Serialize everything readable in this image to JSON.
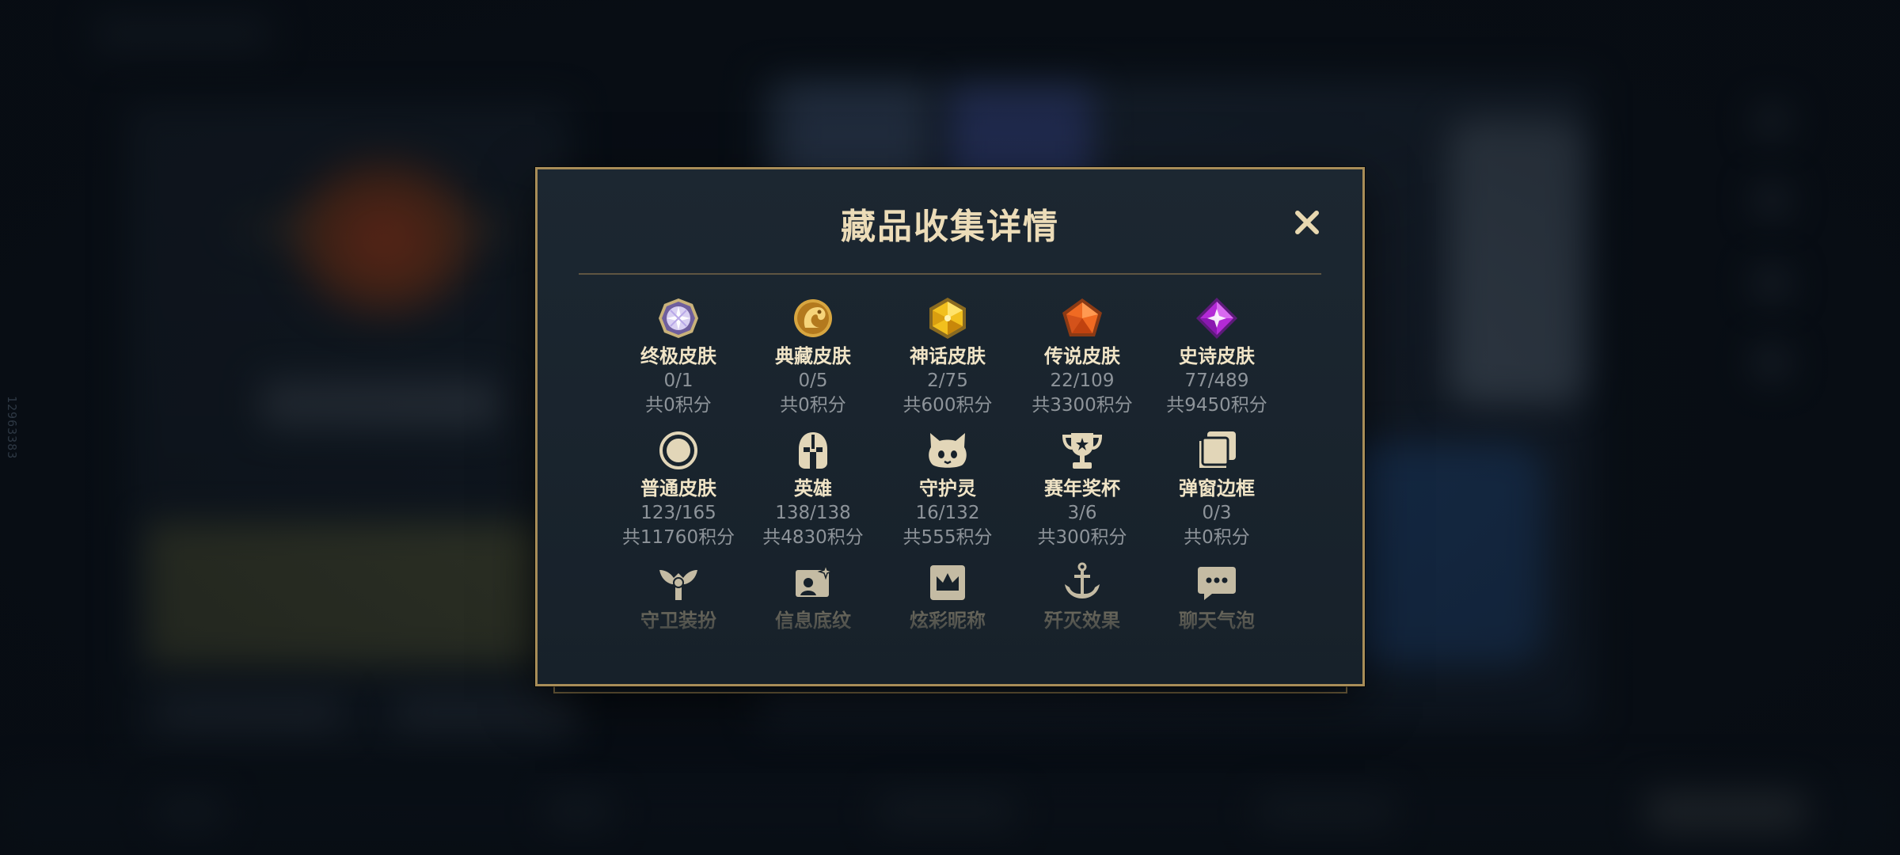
{
  "side_id": "12963383",
  "modal": {
    "title": "藏品收集详情",
    "close_icon": "close-icon"
  },
  "items": [
    {
      "name": "终极皮肤",
      "count": "0/1",
      "points": "共0积分",
      "icon": "ultimate-skin-icon"
    },
    {
      "name": "典藏皮肤",
      "count": "0/5",
      "points": "共0积分",
      "icon": "prestige-skin-icon"
    },
    {
      "name": "神话皮肤",
      "count": "2/75",
      "points": "共600积分",
      "icon": "mythic-skin-icon"
    },
    {
      "name": "传说皮肤",
      "count": "22/109",
      "points": "共3300积分",
      "icon": "legendary-skin-icon"
    },
    {
      "name": "史诗皮肤",
      "count": "77/489",
      "points": "共9450积分",
      "icon": "epic-skin-icon"
    },
    {
      "name": "普通皮肤",
      "count": "123/165",
      "points": "共11760积分",
      "icon": "standard-skin-icon"
    },
    {
      "name": "英雄",
      "count": "138/138",
      "points": "共4830积分",
      "icon": "champion-helmet-icon"
    },
    {
      "name": "守护灵",
      "count": "16/132",
      "points": "共555积分",
      "icon": "guardian-spirit-icon"
    },
    {
      "name": "赛年奖杯",
      "count": "3/6",
      "points": "共300积分",
      "icon": "trophy-icon"
    },
    {
      "name": "弹窗边框",
      "count": "0/3",
      "points": "共0积分",
      "icon": "popup-frame-icon"
    },
    {
      "name": "守卫装扮",
      "icon": "ward-skin-icon"
    },
    {
      "name": "信息底纹",
      "icon": "info-card-icon"
    },
    {
      "name": "炫彩昵称",
      "icon": "nickname-crown-icon"
    },
    {
      "name": "歼灭效果",
      "icon": "anchor-effect-icon"
    },
    {
      "name": "聊天气泡",
      "icon": "chat-bubble-icon"
    }
  ],
  "colors": {
    "accent_gold": "#a88d58",
    "title": "#ecdcb8",
    "text_muted": "#8e949a",
    "modal_bg": "#17212a"
  }
}
